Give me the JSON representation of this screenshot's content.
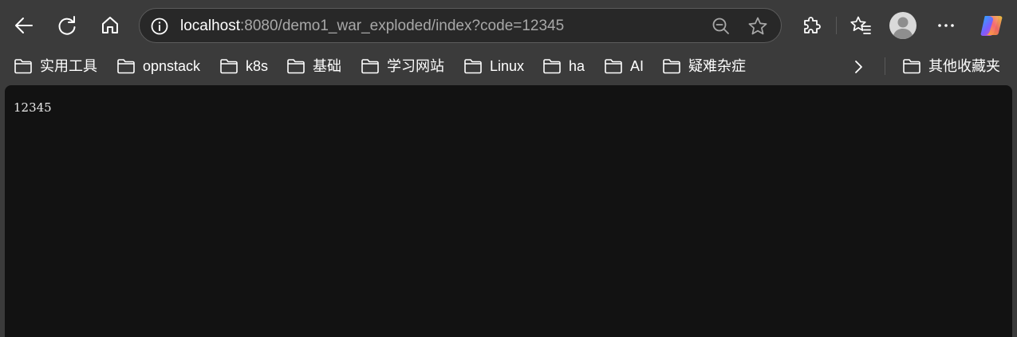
{
  "toolbar": {
    "back_icon": "back-arrow-icon",
    "refresh_icon": "refresh-icon",
    "home_icon": "home-icon",
    "extensions_icon": "puzzle-icon",
    "favorites_icon": "favorites-icon",
    "more_icon": "more-dots-icon",
    "copilot_icon": "copilot-icon"
  },
  "address_bar": {
    "host": "localhost",
    "path": ":8080/demo1_war_exploded/index?code=12345",
    "info_icon": "info-icon",
    "zoom_icon": "zoom-out-icon",
    "favorite_icon": "star-icon"
  },
  "bookmarks": {
    "items": [
      {
        "label": "实用工具"
      },
      {
        "label": "opnstack"
      },
      {
        "label": "k8s"
      },
      {
        "label": "基础"
      },
      {
        "label": "学习网站"
      },
      {
        "label": "Linux"
      },
      {
        "label": "ha"
      },
      {
        "label": "AI"
      },
      {
        "label": "疑难杂症"
      }
    ],
    "other_label": "其他收藏夹"
  },
  "page": {
    "body_text": "12345"
  },
  "colors": {
    "chrome_bg": "#3b3b3b",
    "address_bg": "#282828",
    "page_bg": "#121212",
    "text": "#ffffff",
    "url_dim": "#a8a8a8"
  }
}
